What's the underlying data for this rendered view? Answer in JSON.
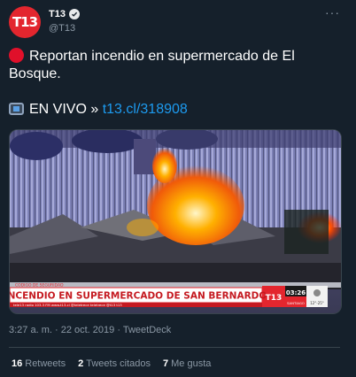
{
  "author": {
    "display_name": "T13",
    "handle": "@T13",
    "avatar_text": "T13"
  },
  "tweet": {
    "text_line1": "Reportan incendio en supermercado de El Bosque.",
    "live_prefix": "EN VIVO »",
    "link_text": "t13.cl/318908"
  },
  "media": {
    "lower_third_kicker": "CODIGO DE SEGURIDAD",
    "headline": "INCENDIO EN SUPERMERCADO DE SAN BERNARDO",
    "ticker": "tele13 radio 103.3 FM   www.t13.cl   @teletrece   teletrece   @t13   t13",
    "channel_logo": "T13",
    "clock": "03:26",
    "location": "SANTIAGO",
    "temperature": "12°-25°"
  },
  "meta": {
    "time": "3:27 a. m.",
    "separator1": "·",
    "date": "22 oct. 2019",
    "separator2": "·",
    "source": "TweetDeck"
  },
  "stats": {
    "retweets_count": "16",
    "retweets_label": "Retweets",
    "quotes_count": "2",
    "quotes_label": "Tweets citados",
    "likes_count": "7",
    "likes_label": "Me gusta"
  },
  "colors": {
    "background": "#15202b",
    "link": "#1d9bf0",
    "brand_red": "#e3262e"
  }
}
